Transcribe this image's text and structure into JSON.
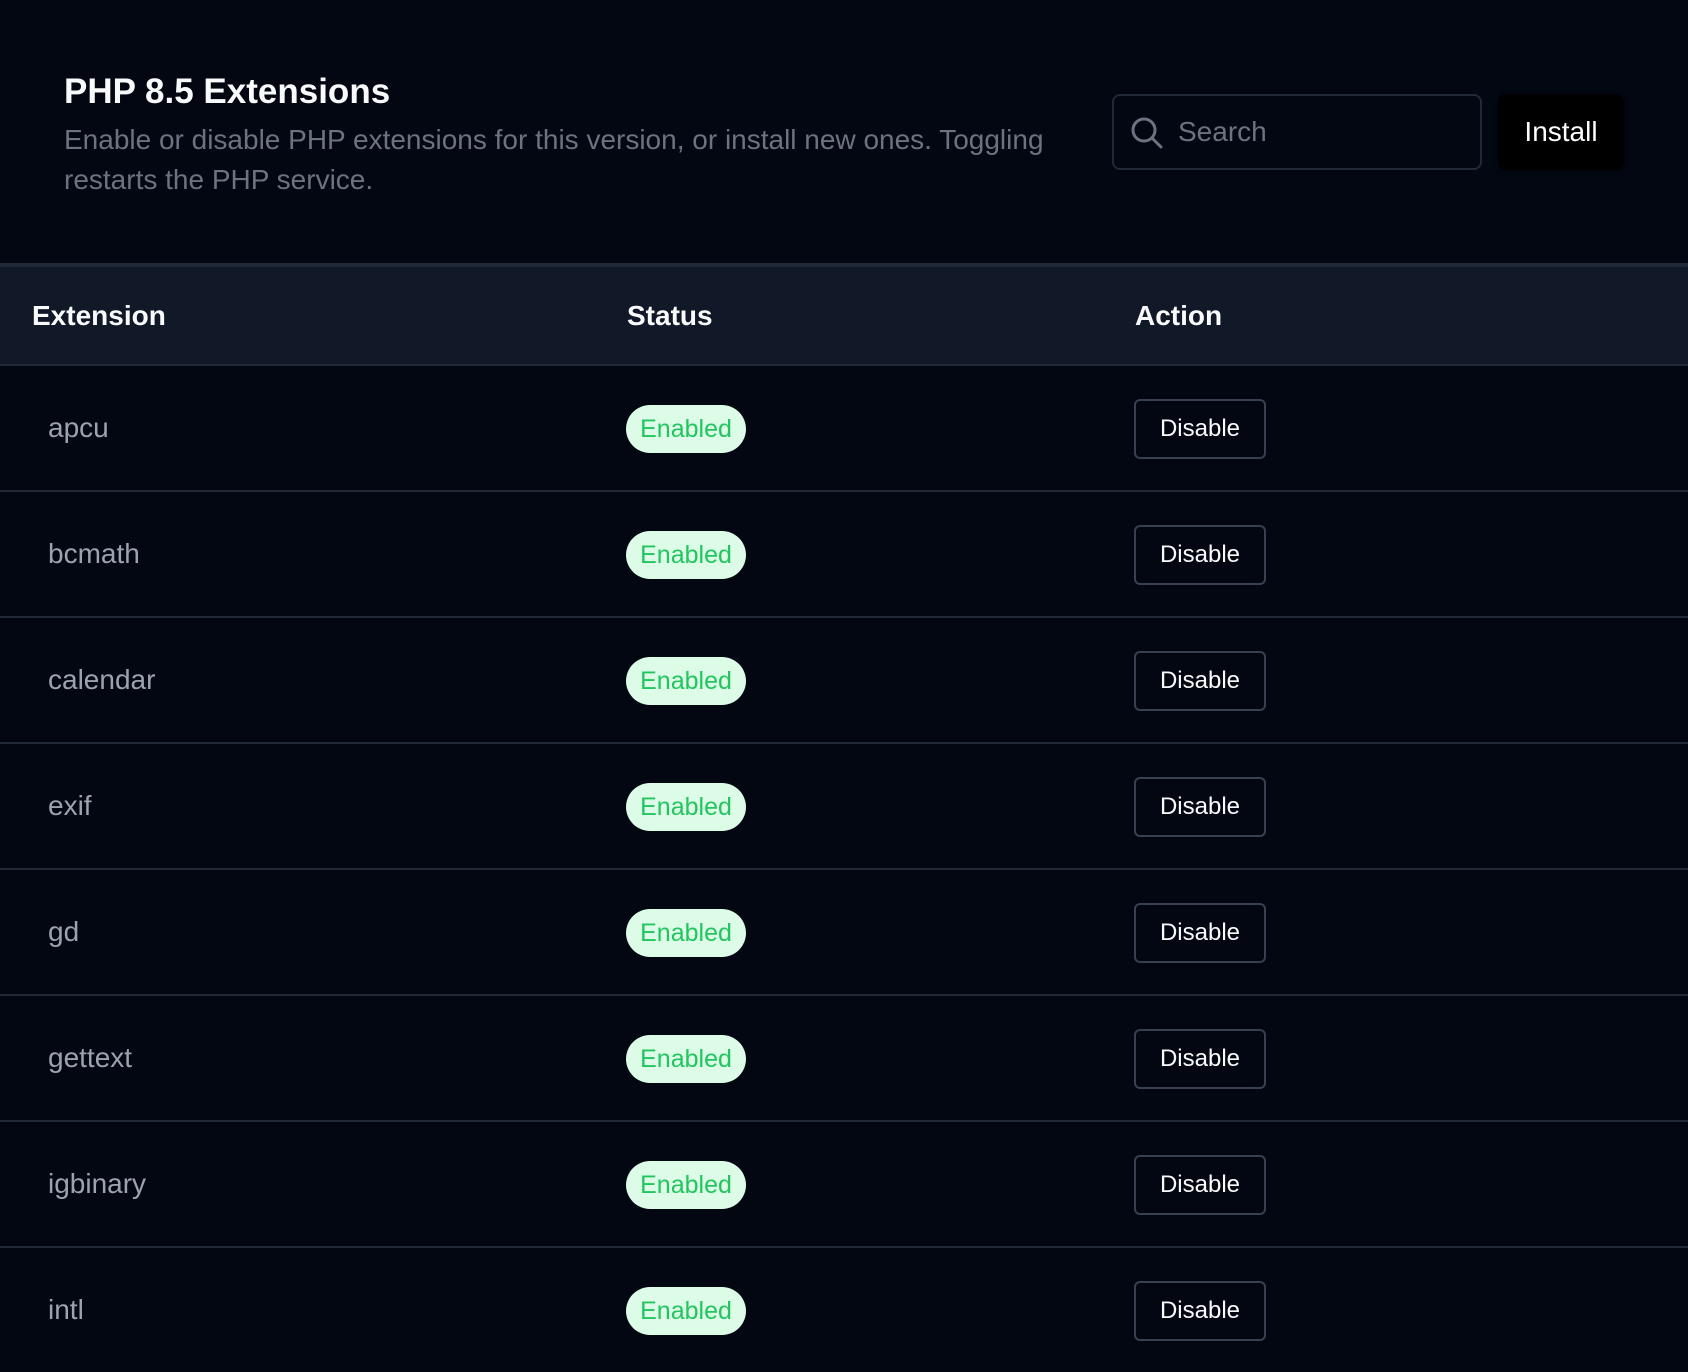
{
  "header": {
    "title": "PHP 8.5 Extensions",
    "description": "Enable or disable PHP extensions for this version, or install new ones. Toggling restarts the PHP service.",
    "search_placeholder": "Search",
    "install_label": "Install"
  },
  "table": {
    "columns": [
      "Extension",
      "Status",
      "Action"
    ],
    "rows": [
      {
        "name": "apcu",
        "status": "Enabled",
        "action": "Disable"
      },
      {
        "name": "bcmath",
        "status": "Enabled",
        "action": "Disable"
      },
      {
        "name": "calendar",
        "status": "Enabled",
        "action": "Disable"
      },
      {
        "name": "exif",
        "status": "Enabled",
        "action": "Disable"
      },
      {
        "name": "gd",
        "status": "Enabled",
        "action": "Disable"
      },
      {
        "name": "gettext",
        "status": "Enabled",
        "action": "Disable"
      },
      {
        "name": "igbinary",
        "status": "Enabled",
        "action": "Disable"
      },
      {
        "name": "intl",
        "status": "Enabled",
        "action": "Disable"
      }
    ]
  },
  "colors": {
    "background": "#030712",
    "header_row": "#111827",
    "badge_bg": "#dcfce7",
    "badge_text": "#22c55e",
    "border": "#1f2937"
  },
  "icons": {
    "search": "search-icon"
  }
}
